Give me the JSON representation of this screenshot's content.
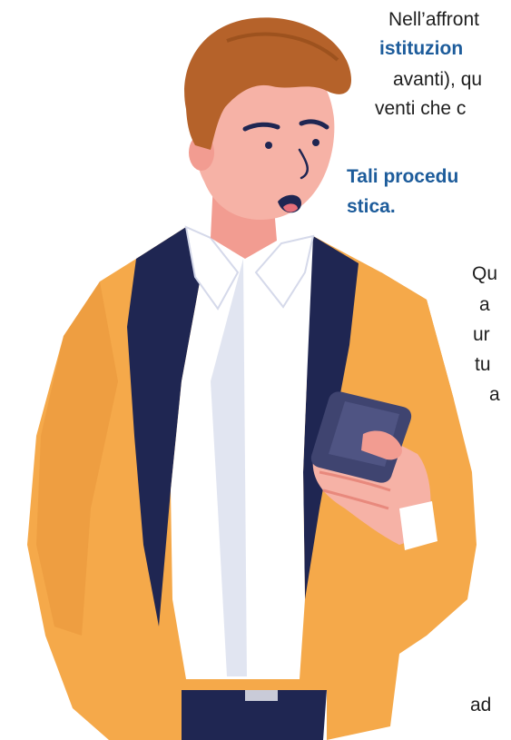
{
  "colors": {
    "text": "#1e1e1e",
    "highlight_blue": "#1d5c9b",
    "jacket": "#f5a94a",
    "lapel": "#1f2652",
    "shirt": "#ffffff",
    "hair": "#b5622a",
    "skin": "#f6b2a6",
    "phone": "#3f4470"
  },
  "paragraph_1": {
    "line_1": "Nell’affront",
    "line_2": "istituzion",
    "line_3": "avanti), qu",
    "line_4": "venti che c"
  },
  "heading": {
    "line_1": "Tali procedu",
    "line_2": "stica."
  },
  "paragraph_2": {
    "lines": [
      "Qu",
      "a",
      "ur",
      "tu",
      "a"
    ]
  },
  "trailing_text": "ad",
  "illustration": {
    "icon": "man-with-smartphone-illustration"
  }
}
